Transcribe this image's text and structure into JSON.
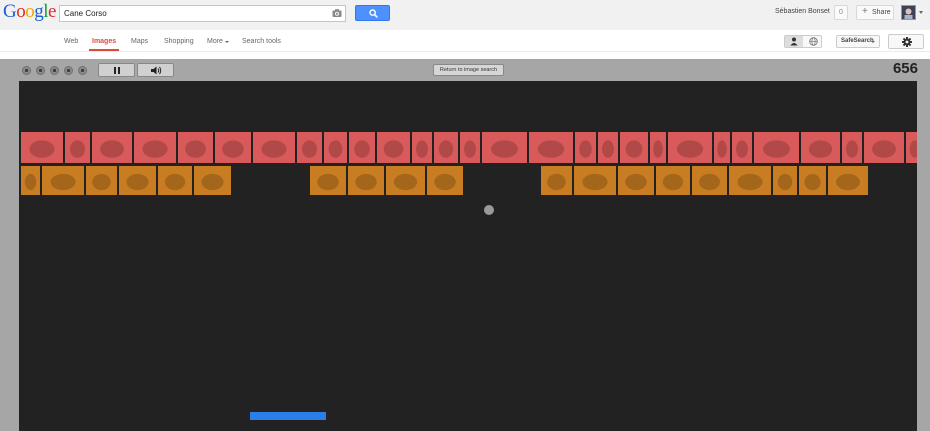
{
  "logo": {
    "letters": [
      "G",
      "o",
      "o",
      "g",
      "l",
      "e"
    ],
    "colors": [
      "#1a5fd6",
      "#dd2b2b",
      "#eea900",
      "#1a5fd6",
      "#159c3b",
      "#dd2b2b"
    ]
  },
  "search": {
    "query": "Cane Corso",
    "camera_icon": "camera-icon",
    "button_icon": "search-icon"
  },
  "user": {
    "name": "Sébastien Bonset",
    "notifications": "0",
    "share_label": "Share",
    "avatar_icon": "avatar"
  },
  "nav": {
    "tabs": [
      {
        "label": "Web"
      },
      {
        "label": "Images",
        "active": true
      },
      {
        "label": "Maps"
      },
      {
        "label": "Shopping"
      },
      {
        "label": "More"
      },
      {
        "label": "Search tools"
      }
    ],
    "safesearch_label": "SafeSearch",
    "settings_icon": "gear-icon"
  },
  "game": {
    "score": "656",
    "return_label": "Return to image search",
    "controls": [
      "pause-icon",
      "speaker-icon"
    ],
    "rows": [
      {
        "color": "#d95a5a",
        "bricks": 30
      },
      {
        "color": "#c97d22",
        "bricks": 23,
        "missing": [
          6,
          7,
          12,
          13
        ]
      }
    ],
    "colors": {
      "background": "#222222",
      "frame": "#a6a6a6",
      "paddle": "#2b7ee8",
      "ball": "#9a9a9a"
    }
  }
}
